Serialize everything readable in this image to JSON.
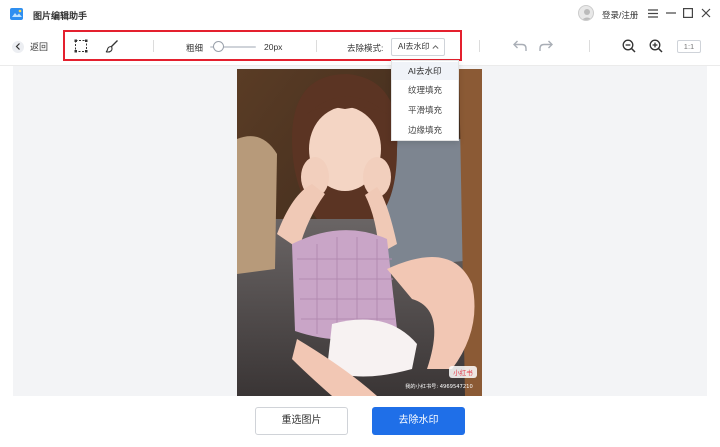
{
  "app": {
    "title": "图片编辑助手",
    "login": "登录/注册"
  },
  "toolbar": {
    "back_label": "返回",
    "brush_label": "粗细",
    "brush_value": "20px",
    "mode_label": "去除模式:",
    "mode_selected": "AI去水印",
    "ratio_label": "1:1"
  },
  "dropdown": {
    "options": [
      "AI去水印",
      "纹理填充",
      "平滑填充",
      "边缘填充"
    ]
  },
  "photo": {
    "watermark_badge": "小红书",
    "watermark_id": "我的小红书号: 4969547210"
  },
  "actions": {
    "reselect": "重选图片",
    "remove": "去除水印"
  },
  "colors": {
    "accent": "#1f6fe8",
    "highlight": "#e4202e"
  }
}
